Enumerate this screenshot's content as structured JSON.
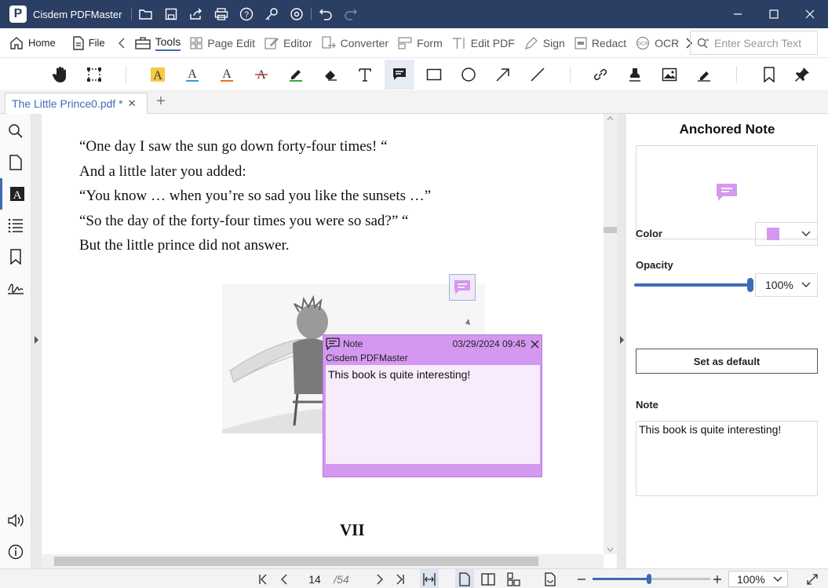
{
  "app": {
    "title": "Cisdem PDFMaster"
  },
  "menu": {
    "home": "Home",
    "file": "File",
    "tools": "Tools",
    "page_edit": "Page Edit",
    "editor": "Editor",
    "converter": "Converter",
    "form": "Form",
    "edit_pdf": "Edit PDF",
    "sign": "Sign",
    "redact": "Redact",
    "ocr": "OCR",
    "search_placeholder": "Enter Search Text"
  },
  "tab": {
    "title": "The Little Prince0.pdf *"
  },
  "document": {
    "lines": [
      "“One day I saw the sun go down forty-four times! “",
      "And a little later you added:",
      "“You know … when you’re so sad you like the sunsets …”",
      "“So the day of the forty-four times you were so sad?” “",
      "But the little prince did not answer."
    ],
    "chapter": "VII"
  },
  "note_popup": {
    "label": "Note",
    "date": "03/29/2024 09:45",
    "author": "Cisdem PDFMaster",
    "text": "This book is quite interesting!"
  },
  "panel": {
    "title": "Anchored Note",
    "color_label": "Color",
    "color_value": "#d498f0",
    "opacity_label": "Opacity",
    "opacity_value": "100%",
    "opacity_fraction": 1.0,
    "default_button": "Set as default",
    "note_label": "Note",
    "note_text": "This book is quite interesting!"
  },
  "status": {
    "page": "14",
    "total": "/54",
    "zoom": "100%",
    "zoom_fraction": 0.48
  },
  "colors": {
    "titlebar": "#2b3e63",
    "accent": "#3f6bb5",
    "note": "#d498f0"
  }
}
